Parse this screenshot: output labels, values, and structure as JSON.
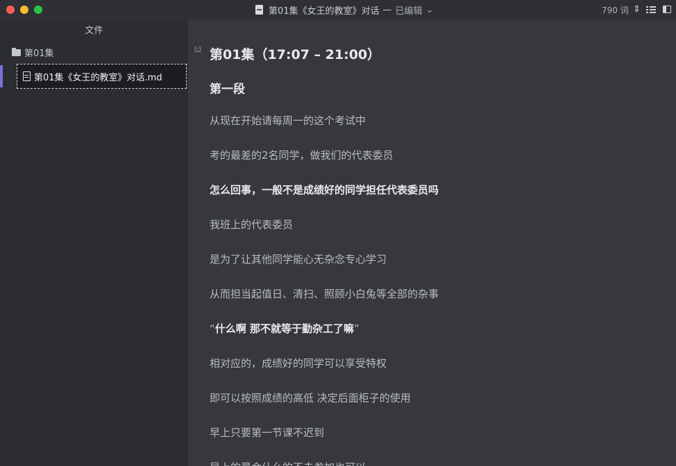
{
  "window": {
    "title": "第01集《女王的教室》对话",
    "title_separator": "—",
    "status": "已编辑",
    "word_count": "790 词"
  },
  "sidebar": {
    "header": "文件",
    "folder": "第01集",
    "file": "第01集《女王的教室》对话.md"
  },
  "editor": {
    "heading_marker": "h3",
    "lines": [
      "第01集（17:07 – 21:00）",
      "第一段",
      "从现在开始请每周一的这个考试中",
      "考的最差的2名同学，做我们的代表委员",
      "怎么回事，一般不是成绩好的同学担任代表委员吗",
      "我班上的代表委员",
      "是为了让其他同学能心无杂念专心学习",
      "从而担当起值日、清扫、照顾小白兔等全部的杂事",
      "“",
      "什么啊 那不就等于勤杂工了嘛",
      "”",
      "相对应的，成绩好的同学可以享受特权",
      "即可以按照成绩的高低 决定后面柜子的使用",
      "早上只要第一节课不迟到",
      "早上的晨会什么的不去参加也可以"
    ]
  },
  "colors": {
    "accent": "#7b72d6",
    "close": "#fe5f57",
    "minimize": "#febc2e",
    "maximize": "#28c840"
  }
}
